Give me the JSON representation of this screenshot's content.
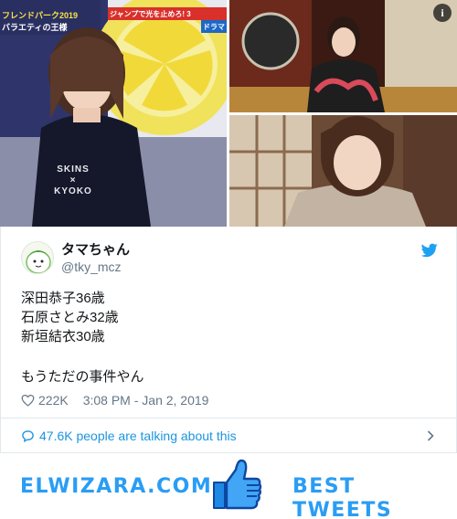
{
  "media": {
    "photo_left_caption_top": "フレンドパーク2019",
    "photo_left_caption_sub": "バラエティの王様",
    "photo_left_caption_center": "ジャンプで光を止めろ! 3",
    "photo_left_caption_right": "ドラマ",
    "shirt_text_1": "SKINS",
    "shirt_text_2": "×",
    "shirt_text_3": "KYOKO",
    "info_icon_glyph": "i"
  },
  "tweet": {
    "display_name": "タマちゃん",
    "handle": "@tky_mcz",
    "lines": [
      "深田恭子36歳",
      "石原さとみ32歳",
      "新垣結衣30歳",
      "",
      "もうただの事件やん"
    ],
    "likes": "222K",
    "timestamp": "3:08 PM - Jan 2, 2019",
    "talking_about": "47.6K people are talking about this"
  },
  "banner": {
    "left_text": "ELWIZARA.COM",
    "right_text": "BEST TWEETS"
  },
  "colors": {
    "twitter_blue": "#1da1f2",
    "link_blue": "#1b95e0",
    "brand_blue": "#2a9df4",
    "gray_text": "#657786"
  },
  "icons": {
    "bird": "twitter-bird-icon",
    "heart": "heart-icon",
    "talk": "speech-bubble-icon",
    "chevron": "chevron-right-icon",
    "thumb": "thumbs-up-icon",
    "info": "info-icon"
  }
}
